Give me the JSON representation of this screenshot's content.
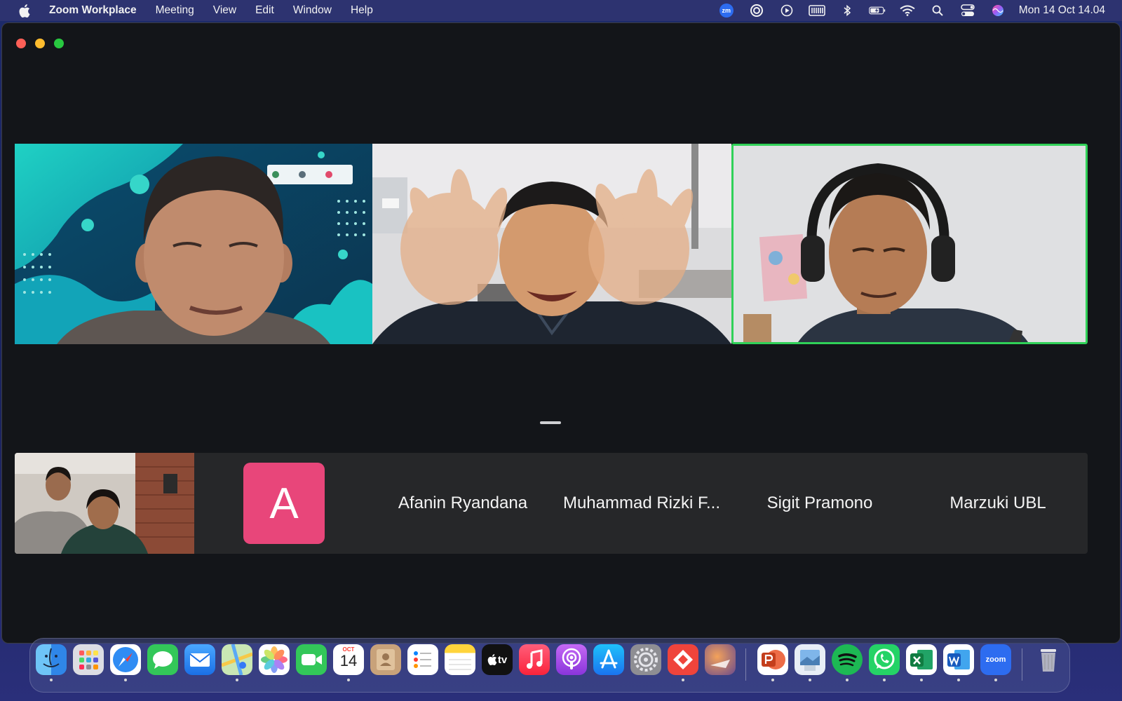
{
  "menubar": {
    "app_name": "Zoom Workplace",
    "menus": [
      "Meeting",
      "View",
      "Edit",
      "Window",
      "Help"
    ],
    "zoom_badge": "zm",
    "status_icons": [
      "zoom-status-icon",
      "focus-icon",
      "play-icon",
      "keyboard-icon",
      "bluetooth-icon",
      "battery-icon",
      "wifi-icon",
      "search-icon",
      "control-center-icon",
      "siri-icon"
    ],
    "clock": "Mon 14 Oct  14.04"
  },
  "meeting": {
    "video_tiles": [
      {
        "name": "participant-video-1",
        "active_speaker": false
      },
      {
        "name": "participant-video-2",
        "active_speaker": false
      },
      {
        "name": "participant-video-3",
        "active_speaker": true
      }
    ],
    "active_speaker_color": "#30d158",
    "strip": {
      "avatar_letter": "A",
      "avatar_color": "#e8467a",
      "names": [
        "Afanin Ryandana",
        "Muhammad Rizki F...",
        "Sigit Pramono",
        "Marzuki UBL"
      ]
    }
  },
  "dock": {
    "calendar_month": "OCT",
    "calendar_day": "14",
    "tv_label": "tv",
    "zoom_label": "zoom",
    "apps": [
      "finder",
      "launchpad",
      "safari",
      "messages",
      "mail",
      "maps",
      "photos",
      "facetime",
      "calendar",
      "contacts",
      "reminders",
      "notes",
      "apple-tv",
      "music",
      "podcasts",
      "app-store",
      "system-settings",
      "anydesk",
      "migration-assistant",
      "powerpoint",
      "preview",
      "spotify",
      "whatsapp",
      "excel",
      "word",
      "zoom",
      "trash"
    ]
  }
}
